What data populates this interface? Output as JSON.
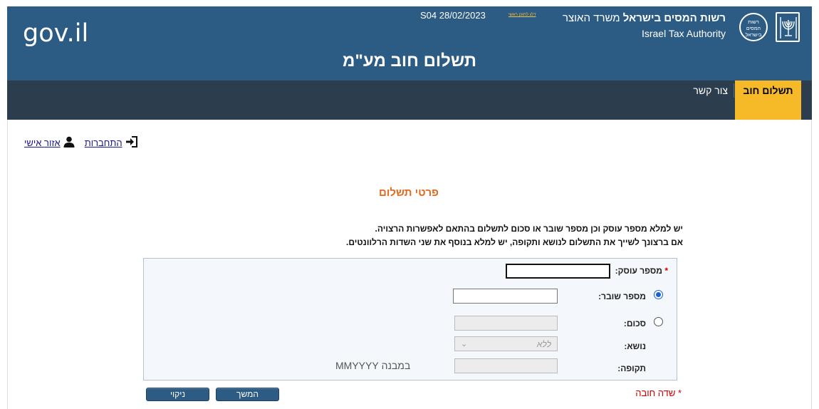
{
  "header": {
    "logo": "gov.il",
    "system_line": "S04 28/02/2023",
    "skip_link": "דלג לתוכן ראשי",
    "authority_he_bold": "רשות המסים בישראל",
    "authority_he_rest": " משרד האוצר",
    "authority_en": "Israel Tax Authority",
    "emblem_text": "רשות המסים בישראל",
    "page_title": "תשלום חוב מע\"מ"
  },
  "nav": {
    "active_tab": "תשלום חוב",
    "contact": "צור קשר"
  },
  "login": {
    "personal_area": "אזור אישי",
    "login": "התחברות"
  },
  "section": {
    "title": "פרטי תשלום",
    "instructions": [
      "יש למלא מספר עוסק וכן מספר שובר או סכום לתשלום בהתאם לאפשרות הרצויה.",
      "אם ברצונך לשייך את התשלום לנושא ותקופה, יש למלא בנוסף את שני השדות הרלוונטים."
    ]
  },
  "form": {
    "dealer_label": "מספר עוסק:",
    "dealer_value": "",
    "voucher_label": "מספר שובר:",
    "voucher_value": "",
    "voucher_selected": true,
    "amount_label": "סכום:",
    "amount_value": "",
    "amount_selected": false,
    "subject_label": "נושא:",
    "subject_value": "ללא",
    "period_label": "תקופה:",
    "period_value": "",
    "period_hint": "במבנה MMYYYY"
  },
  "footer": {
    "continue_button": "המשך",
    "clear_button": "ניקוי",
    "required_note": "שדה חובה"
  },
  "colors": {
    "header_bg": "#2c5b84",
    "nav_bg": "#2c3e4d",
    "active_tab_bg": "#f6ba28",
    "section_title": "#e06a1e",
    "required": "#cc0000"
  }
}
